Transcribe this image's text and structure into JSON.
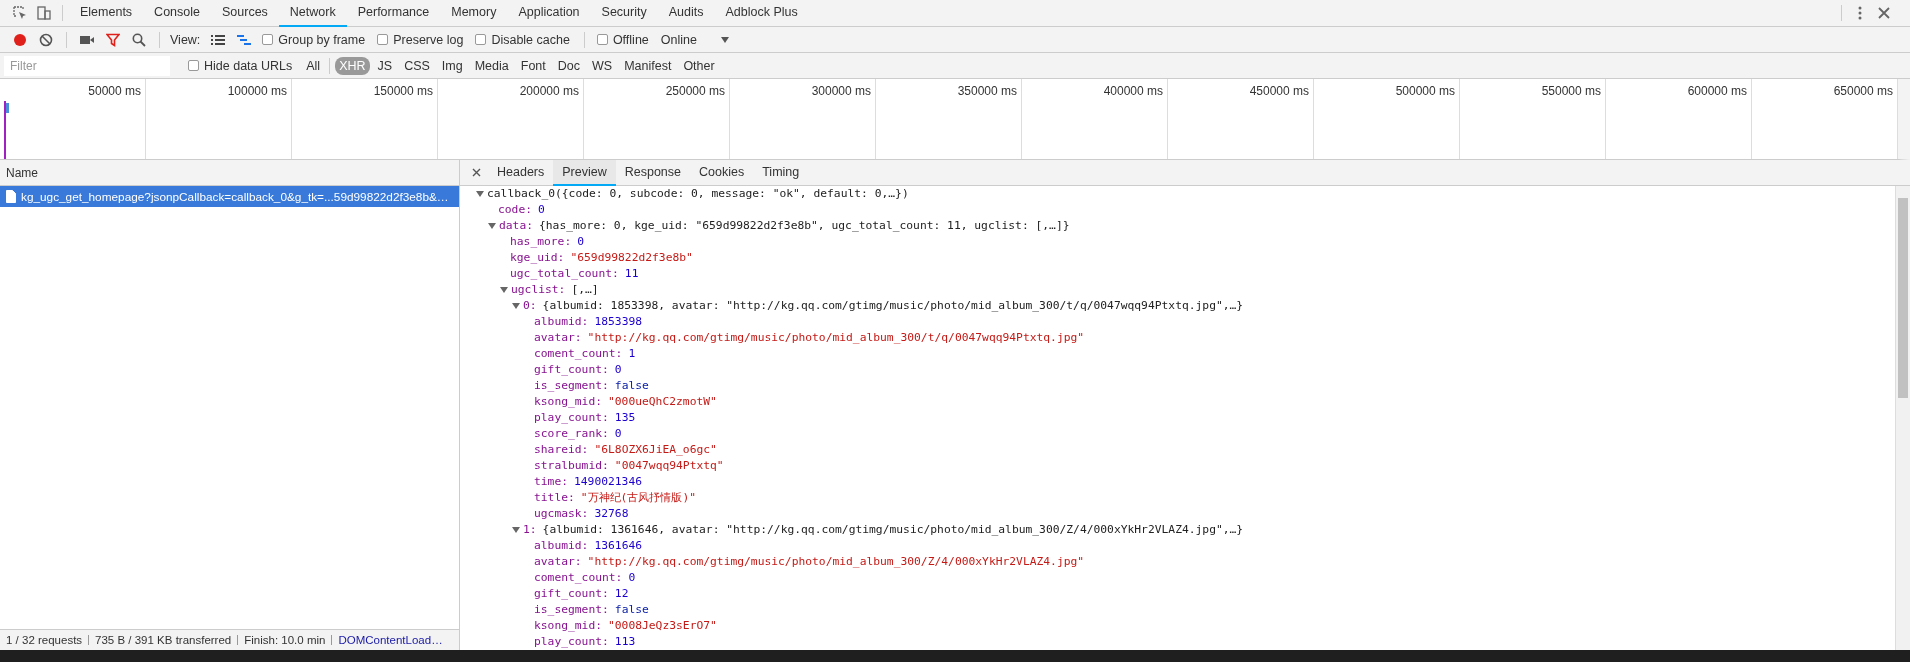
{
  "main_tabs": [
    {
      "label": "Elements",
      "selected": false
    },
    {
      "label": "Console",
      "selected": false
    },
    {
      "label": "Sources",
      "selected": false
    },
    {
      "label": "Network",
      "selected": true
    },
    {
      "label": "Performance",
      "selected": false
    },
    {
      "label": "Memory",
      "selected": false
    },
    {
      "label": "Application",
      "selected": false
    },
    {
      "label": "Security",
      "selected": false
    },
    {
      "label": "Audits",
      "selected": false
    },
    {
      "label": "Adblock Plus",
      "selected": false
    }
  ],
  "toolbar": {
    "recording": true,
    "filter_active": true,
    "view_label": "View:",
    "view_modes": [
      {
        "kind": "list",
        "selected": false
      },
      {
        "kind": "waterfall",
        "selected": true
      }
    ],
    "checkboxes": [
      {
        "label": "Group by frame",
        "checked": false
      },
      {
        "label": "Preserve log",
        "checked": false
      },
      {
        "label": "Disable cache",
        "checked": false
      },
      {
        "label": "Offline",
        "checked": false
      }
    ],
    "throttling": "Online"
  },
  "filter_bar": {
    "placeholder": "Filter",
    "hide_data_urls": {
      "label": "Hide data URLs",
      "checked": false
    },
    "types": [
      {
        "label": "All",
        "selected": false
      },
      {
        "label": "XHR",
        "selected": true
      },
      {
        "label": "JS",
        "selected": false
      },
      {
        "label": "CSS",
        "selected": false
      },
      {
        "label": "Img",
        "selected": false
      },
      {
        "label": "Media",
        "selected": false
      },
      {
        "label": "Font",
        "selected": false
      },
      {
        "label": "Doc",
        "selected": false
      },
      {
        "label": "WS",
        "selected": false
      },
      {
        "label": "Manifest",
        "selected": false
      },
      {
        "label": "Other",
        "selected": false
      }
    ]
  },
  "overview": {
    "ticks": [
      "50000 ms",
      "100000 ms",
      "150000 ms",
      "200000 ms",
      "250000 ms",
      "300000 ms",
      "350000 ms",
      "400000 ms",
      "450000 ms",
      "500000 ms",
      "550000 ms",
      "600000 ms",
      "650000 ms"
    ]
  },
  "requests": {
    "column": "Name",
    "rows": [
      {
        "name": "kg_ugc_get_homepage?jsonpCallback=callback_0&g_tk=...59d99822d2f3e8b&…",
        "selected": true
      }
    ]
  },
  "status_bar": {
    "requests": "1 / 32 requests",
    "transferred": "735 B / 391 KB transferred",
    "finish": "Finish: 10.0 min",
    "dom_content_loaded": "DOMContentLoad…"
  },
  "detail_tabs": [
    {
      "label": "Headers",
      "selected": false
    },
    {
      "label": "Preview",
      "selected": true
    },
    {
      "label": "Response",
      "selected": false
    },
    {
      "label": "Cookies",
      "selected": false
    },
    {
      "label": "Timing",
      "selected": false
    }
  ],
  "preview": [
    {
      "kind": "root",
      "label": "callback_0({code: 0, subcode: 0, message: \"ok\", default: 0,…})",
      "expanded": true,
      "children": [
        {
          "kind": "number",
          "label": "code:",
          "value": "0"
        },
        {
          "kind": "object",
          "label": "data:",
          "value": "{has_more: 0, kge_uid: \"659d99822d2f3e8b\", ugc_total_count: 11, ugclist: [,…]}",
          "expanded": true,
          "children": [
            {
              "kind": "number",
              "label": "has_more:",
              "value": "0"
            },
            {
              "kind": "string",
              "label": "kge_uid:",
              "value": "\"659d99822d2f3e8b\""
            },
            {
              "kind": "number",
              "label": "ugc_total_count:",
              "value": "11"
            },
            {
              "kind": "object",
              "label": "ugclist:",
              "value": "[,…]",
              "expanded": true,
              "children": [
                {
                  "kind": "object",
                  "label": "0:",
                  "value": "{albumid: 1853398, avatar: \"http://kg.qq.com/gtimg/music/photo/mid_album_300/t/q/0047wqq94Ptxtq.jpg\",…}",
                  "expanded": true,
                  "children": [
                    {
                      "kind": "number",
                      "label": "albumid:",
                      "value": "1853398"
                    },
                    {
                      "kind": "string",
                      "label": "avatar:",
                      "value": "\"http://kg.qq.com/gtimg/music/photo/mid_album_300/t/q/0047wqq94Ptxtq.jpg\""
                    },
                    {
                      "kind": "number",
                      "label": "coment_count:",
                      "value": "1"
                    },
                    {
                      "kind": "number",
                      "label": "gift_count:",
                      "value": "0"
                    },
                    {
                      "kind": "boolean",
                      "label": "is_segment:",
                      "value": "false"
                    },
                    {
                      "kind": "string",
                      "label": "ksong_mid:",
                      "value": "\"000ueQhC2zmotW\""
                    },
                    {
                      "kind": "number",
                      "label": "play_count:",
                      "value": "135"
                    },
                    {
                      "kind": "number",
                      "label": "score_rank:",
                      "value": "0"
                    },
                    {
                      "kind": "string",
                      "label": "shareid:",
                      "value": "\"6L8OZX6JiEA_o6gc\""
                    },
                    {
                      "kind": "string",
                      "label": "stralbumid:",
                      "value": "\"0047wqq94Ptxtq\""
                    },
                    {
                      "kind": "number",
                      "label": "time:",
                      "value": "1490021346"
                    },
                    {
                      "kind": "string",
                      "label": "title:",
                      "value": "\"万神纪(古风抒情版)\""
                    },
                    {
                      "kind": "number",
                      "label": "ugcmask:",
                      "value": "32768"
                    }
                  ]
                },
                {
                  "kind": "object",
                  "label": "1:",
                  "value": "{albumid: 1361646, avatar: \"http://kg.qq.com/gtimg/music/photo/mid_album_300/Z/4/000xYkHr2VLAZ4.jpg\",…}",
                  "expanded": true,
                  "children": [
                    {
                      "kind": "number",
                      "label": "albumid:",
                      "value": "1361646"
                    },
                    {
                      "kind": "string",
                      "label": "avatar:",
                      "value": "\"http://kg.qq.com/gtimg/music/photo/mid_album_300/Z/4/000xYkHr2VLAZ4.jpg\""
                    },
                    {
                      "kind": "number",
                      "label": "coment_count:",
                      "value": "0"
                    },
                    {
                      "kind": "number",
                      "label": "gift_count:",
                      "value": "12"
                    },
                    {
                      "kind": "boolean",
                      "label": "is_segment:",
                      "value": "false"
                    },
                    {
                      "kind": "string",
                      "label": "ksong_mid:",
                      "value": "\"0008JeQz3sErO7\""
                    },
                    {
                      "kind": "number",
                      "label": "play_count:",
                      "value": "113"
                    }
                  ]
                }
              ]
            }
          ]
        }
      ]
    }
  ]
}
